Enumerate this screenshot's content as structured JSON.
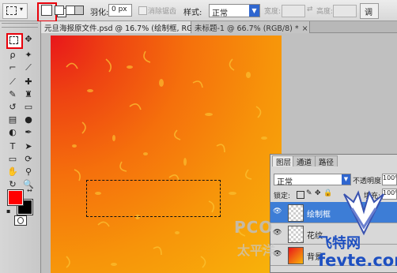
{
  "options_bar": {
    "feather_label": "羽化:",
    "feather_value": "0 px",
    "antialias_label": "消除锯齿",
    "style_label": "样式:",
    "style_value": "正常",
    "width_label": "宽度:",
    "height_label": "高度:",
    "refine_label": "调"
  },
  "tabs": [
    {
      "label": "元旦海报原文件.psd @ 16.7% (绘制框, RGB/8) *",
      "close": "×"
    },
    {
      "label": "未标题-1 @ 66.7% (RGB/8) *",
      "close": "×"
    }
  ],
  "layers_panel": {
    "tabs": [
      "图层",
      "通道",
      "路径"
    ],
    "blend_mode": "正常",
    "opacity_label": "不透明度:",
    "opacity_value": "100%",
    "lock_label": "锁定:",
    "fill_label": "填充:",
    "fill_value": "100%",
    "layers": [
      {
        "name": "绘制框"
      },
      {
        "name": "花纹"
      },
      {
        "name": "背景"
      }
    ]
  },
  "watermarks": {
    "pconline": "PCO",
    "pc_sub": "太平洋",
    "site_cn": "飞特网",
    "site_url": "fevte.com"
  },
  "colors": {
    "highlight_red": "#e8000a",
    "foreground": "#ff0000",
    "background": "#000000",
    "selected_layer": "#3d7dd6"
  }
}
